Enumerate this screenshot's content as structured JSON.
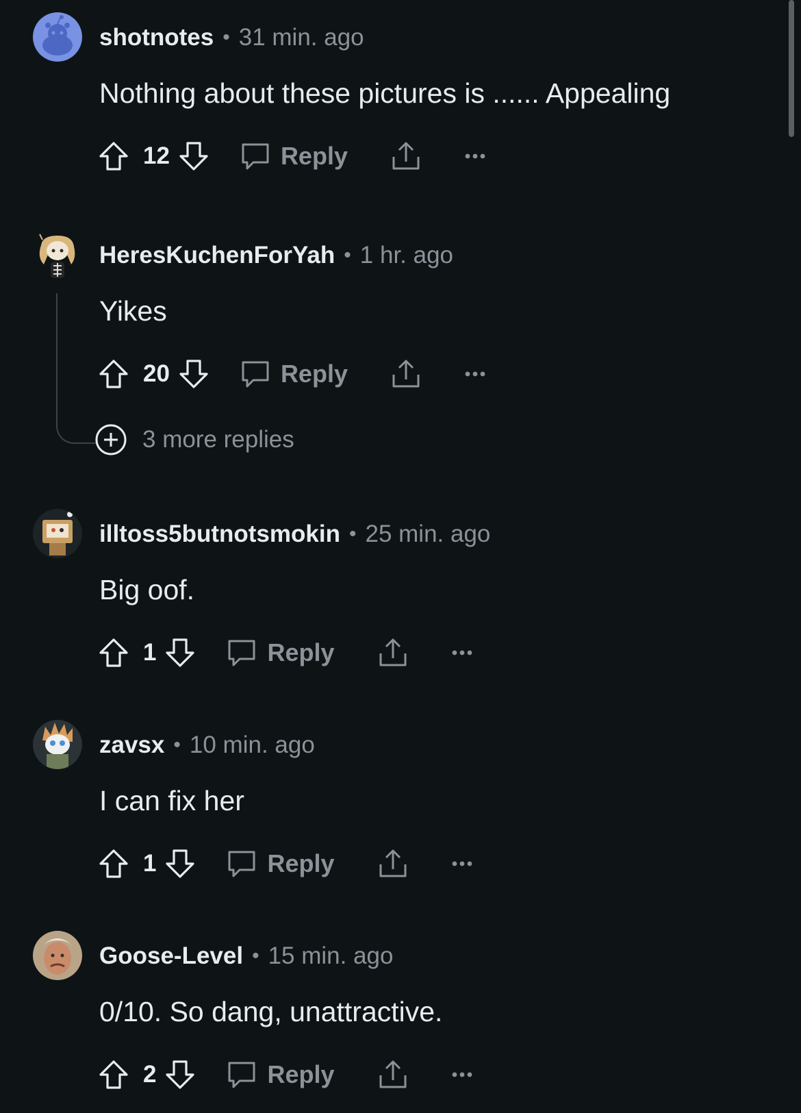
{
  "comments": [
    {
      "username": "shotnotes",
      "time": "31 min. ago",
      "text": "Nothing about these pictures is ...... Appealing",
      "votes": "12",
      "reply_label": "Reply",
      "avatar": "default-snoo-avatar"
    },
    {
      "username": "HeresKuchenForYah",
      "time": "1 hr. ago",
      "text": "Yikes",
      "votes": "20",
      "reply_label": "Reply",
      "avatar": "snoo-blonde-avatar",
      "more_replies": "3 more replies"
    },
    {
      "username": "illtoss5butnotsmokin",
      "time": "25 min. ago",
      "text": "Big oof.",
      "votes": "1",
      "reply_label": "Reply",
      "avatar": "snoo-box-head-avatar"
    },
    {
      "username": "zavsx",
      "time": "10 min. ago",
      "text": "I can fix her",
      "votes": "1",
      "reply_label": "Reply",
      "avatar": "snoo-spiky-hair-avatar"
    },
    {
      "username": "Goose-Level",
      "time": "15 min. ago",
      "text": "0/10. So dang, unattractive.",
      "votes": "2",
      "reply_label": "Reply",
      "avatar": "photo-face-avatar"
    }
  ],
  "separator": "•",
  "colors": {
    "background": "#0e1416",
    "primary_text": "#e9ecee",
    "secondary_text": "#8b9298",
    "thread_line": "#3c4247"
  }
}
